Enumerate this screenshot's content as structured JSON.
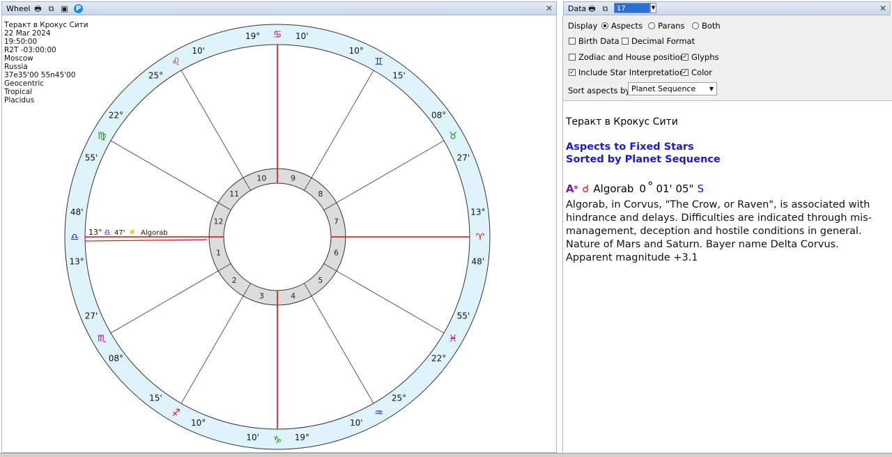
{
  "wheel_window": {
    "title": "Wheel",
    "icons": [
      "print-icon",
      "copy-icon",
      "save-icon",
      "p-icon"
    ]
  },
  "chart_info": [
    "Теракт в Крокус Сити",
    "22 Mar 2024",
    "19:50:00",
    "R2T -03:00:00",
    "Moscow",
    "Russia",
    "37e35'00 55n45'00",
    "Geocentric",
    "Tropical",
    "Placidus"
  ],
  "wheel": {
    "signs": [
      {
        "deg": "19°",
        "glyph": "♋",
        "min": "10'",
        "color": "#b0007a"
      },
      {
        "deg": "10°",
        "glyph": "♊",
        "min": "15'",
        "color": "#1a1ad0"
      },
      {
        "deg": "08°",
        "glyph": "♉",
        "min": "27'",
        "color": "#138a13"
      },
      {
        "deg": "13°",
        "glyph": "♈",
        "min": "48'",
        "color": "#d01010"
      },
      {
        "deg": "55'",
        "glyph": "♓",
        "min": "22°",
        "color": "#b0007a"
      },
      {
        "deg": "25°",
        "glyph": "♒",
        "min": "10'",
        "color": "#1a1ad0"
      },
      {
        "deg": "19°",
        "glyph": "♑",
        "min": "10'",
        "color": "#138a13"
      },
      {
        "deg": "10°",
        "glyph": "♐",
        "min": "15'",
        "color": "#d01010"
      },
      {
        "deg": "08°",
        "glyph": "♏",
        "min": "27'",
        "color": "#b0007a"
      },
      {
        "deg": "13°",
        "glyph": "♎",
        "min": "48'",
        "color": "#1a1ad0"
      },
      {
        "deg": "55'",
        "glyph": "♍",
        "min": "22°",
        "color": "#138a13"
      },
      {
        "deg": "25°",
        "glyph": "♌",
        "min": "10'",
        "color": "#d01010"
      }
    ],
    "houses": [
      "1",
      "2",
      "3",
      "4",
      "5",
      "6",
      "7",
      "8",
      "9",
      "10",
      "11",
      "12"
    ],
    "star_marker": {
      "deg": "13°",
      "glyph": "♎",
      "min": "47'",
      "star_glyph": "✶",
      "name": "Algorab",
      "star_color": "#e8c000"
    },
    "colors": {
      "ring_fill": "#dff3fb",
      "axis": "#d01010",
      "house_ring": "#dcdcdc",
      "line": "#333333"
    }
  },
  "data_window": {
    "title": "Data",
    "number_value": "17",
    "icons": [
      "print-icon",
      "copy-icon"
    ]
  },
  "options": {
    "display_label": "Display",
    "display_options": [
      "Aspects",
      "Parans",
      "Both"
    ],
    "display_selected": "Aspects",
    "birth_data": {
      "label": "Birth Data",
      "checked": false
    },
    "decimal_format": {
      "label": "Decimal Format",
      "checked": false
    },
    "zodiac_house": {
      "label": "Zodiac and House position",
      "checked": false
    },
    "glyphs": {
      "label": "Glyphs",
      "checked": true
    },
    "include_star": {
      "label": "Include Star Interpretations",
      "checked": true
    },
    "color": {
      "label": "Color",
      "checked": true
    },
    "sort_label": "Sort aspects by",
    "sort_value": "Planet Sequence"
  },
  "report": {
    "title": "Теракт в Крокус Сити",
    "heading1": "Aspects to Fixed Stars",
    "heading2": "Sorted by Planet Sequence",
    "aspect": {
      "point_glyph": "Aˢ",
      "aspect_glyph": "☌",
      "star": "Algorab",
      "deg": "0",
      "deg_sign": "°",
      "rest": "01' 05\"",
      "flag": "S",
      "point_color": "#7a1a9a",
      "aspect_color": "#d01010",
      "flag_color": "#1a1ad0"
    },
    "description": "Algorab, in Corvus, \"The Crow, or Raven\", is associated with hindrance and delays. Difficulties are indicated through mis-management, deception and hostile conditions in general. Nature of Mars and Saturn. Bayer name Delta Corvus. Apparent magnitude +3.1"
  }
}
